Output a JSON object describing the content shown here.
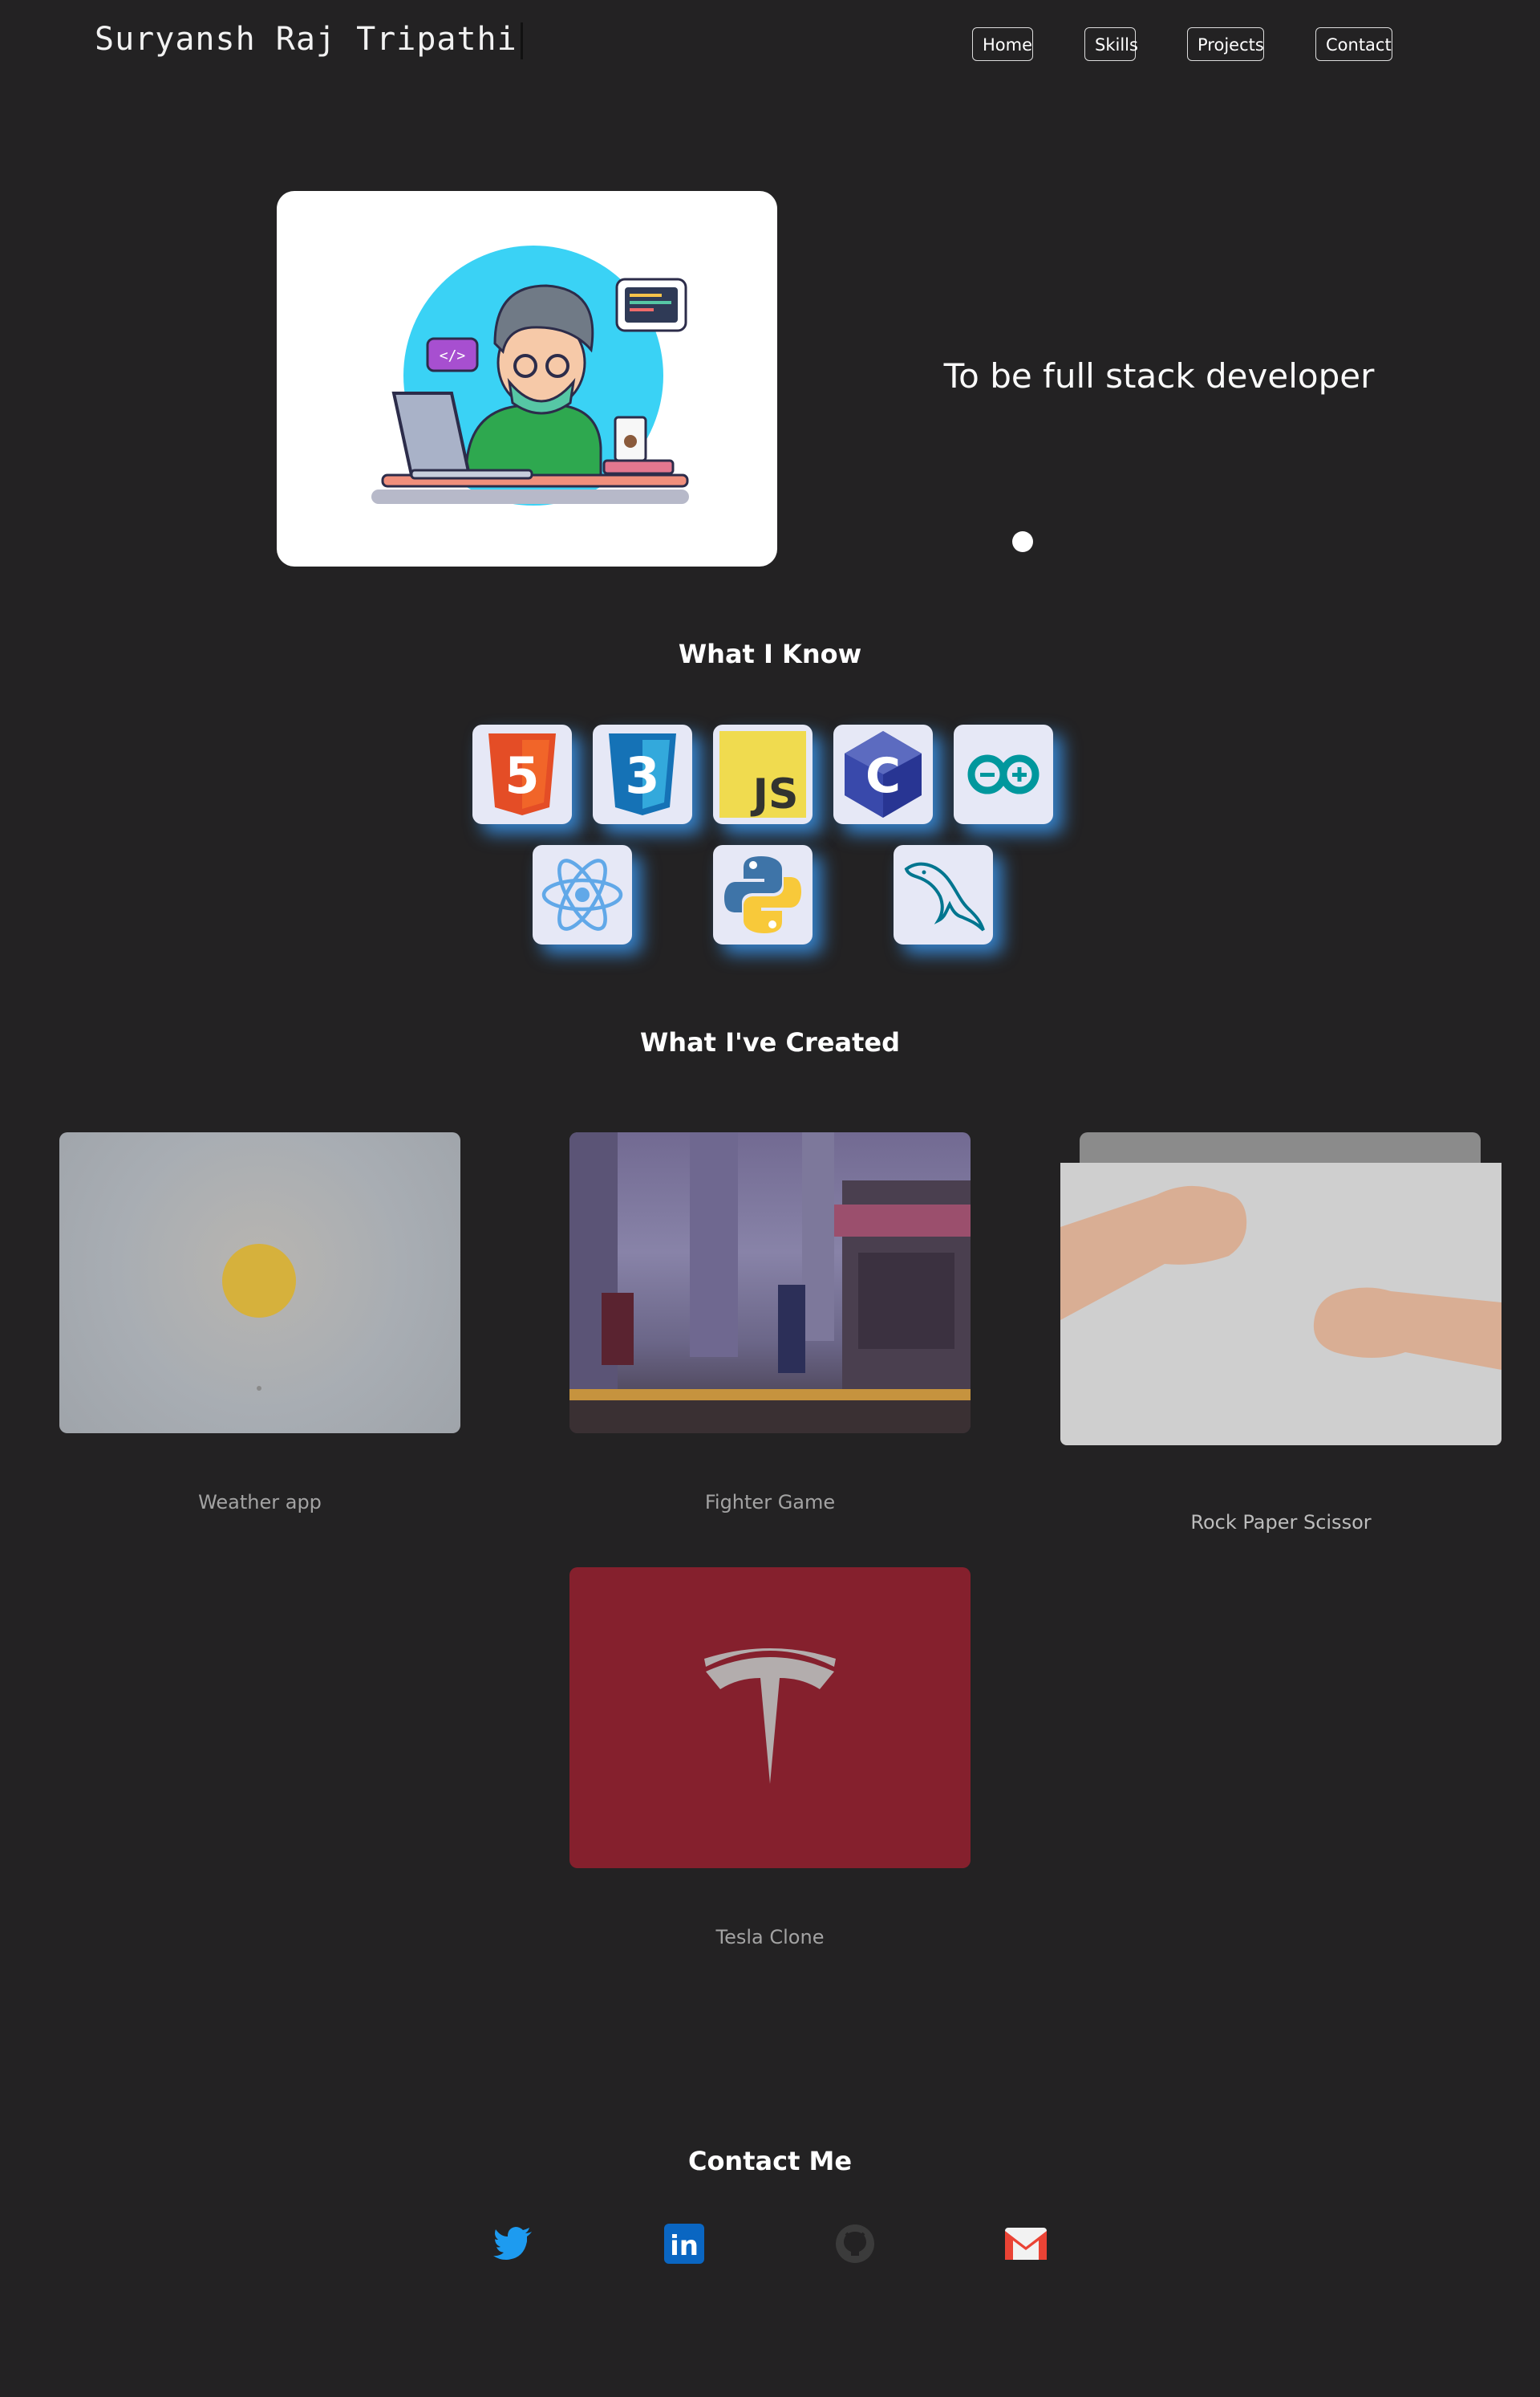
{
  "header": {
    "brand": "Suryansh Raj Tripathi",
    "nav": [
      "Home",
      "Skills",
      "Projects",
      "Contact"
    ]
  },
  "hero": {
    "tagline": "To be full stack developer"
  },
  "skills": {
    "title": "What I Know",
    "items": [
      {
        "name": "HTML5",
        "icon": "html5-icon",
        "label": "5"
      },
      {
        "name": "CSS3",
        "icon": "css3-icon",
        "label": "3"
      },
      {
        "name": "JavaScript",
        "icon": "javascript-icon",
        "label": "JS"
      },
      {
        "name": "C",
        "icon": "c-language-icon",
        "label": "C"
      },
      {
        "name": "Arduino",
        "icon": "arduino-icon",
        "label": ""
      },
      {
        "name": "React",
        "icon": "react-icon",
        "label": ""
      },
      {
        "name": "Python",
        "icon": "python-icon",
        "label": ""
      },
      {
        "name": "MySQL",
        "icon": "mysql-icon",
        "label": ""
      }
    ]
  },
  "projects": {
    "title": "What I've Created",
    "items": [
      {
        "label": "Weather app"
      },
      {
        "label": "Fighter Game"
      },
      {
        "label": "Rock Paper Scissor"
      },
      {
        "label": "Tesla Clone"
      }
    ]
  },
  "contact": {
    "title": "Contact Me",
    "links": [
      {
        "icon": "twitter-icon",
        "color": "#1d9bf0"
      },
      {
        "icon": "linkedin-icon",
        "color": "#0a66c2"
      },
      {
        "icon": "github-icon",
        "color": "#3b3b3b"
      },
      {
        "icon": "gmail-icon",
        "color": "#ea4335"
      }
    ],
    "linkedin_text": "in"
  },
  "colors": {
    "background": "#232223",
    "skill_shadow": "#3ca0ff",
    "tesla_red": "#85202d"
  }
}
